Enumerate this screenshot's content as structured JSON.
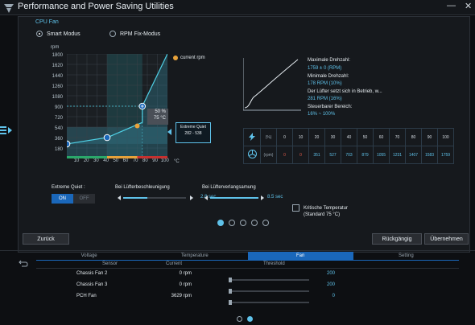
{
  "window": {
    "title": "Performance and Power Saving Utilities",
    "minimize": "—",
    "close": "✕"
  },
  "section": {
    "title": "CPU Fan"
  },
  "mode": {
    "smart": "Smart Modus",
    "fix": "RPM Fix-Modus",
    "selected": "smart"
  },
  "chart": {
    "ylabel": "rpm",
    "yticks": [
      "1800",
      "1620",
      "1440",
      "1260",
      "1080",
      "900",
      "720",
      "540",
      "360",
      "180"
    ],
    "xticks": [
      "10",
      "20",
      "30",
      "40",
      "50",
      "60",
      "70",
      "80",
      "90",
      "100"
    ],
    "xunit": "°C",
    "legend": "current rpm",
    "tooltip_pct": "50 %",
    "tooltip_temp": "75 °C",
    "badge_title": "Extreme Quiet",
    "badge_range": "282 - 538"
  },
  "chart_data": {
    "type": "line",
    "xlabel": "°C",
    "ylabel": "rpm",
    "x_range": [
      0,
      100
    ],
    "y_range": [
      0,
      1800
    ],
    "series": [
      {
        "name": "curve",
        "x": [
          0,
          40,
          75,
          75,
          100
        ],
        "y": [
          250,
          360,
          620,
          900,
          1800
        ]
      }
    ],
    "current": {
      "x": 70,
      "y": 560
    }
  },
  "info": {
    "max_label": "Maximale Drehzahl:",
    "max_val": "1759 ± 0 (RPM)",
    "min_label": "Minimale Drehzahl:",
    "min_val": "178 RPM (10%)",
    "start_label": "Der Lüfter setzt sich in Betrieb, w...",
    "start_val": "281 RPM (16%)",
    "range_label": "Steuerbarer Bereich:",
    "range_val": "16% ~ 100%"
  },
  "table": {
    "pct_header": "(%)",
    "rpm_header": "(rpm)",
    "pct": [
      "0",
      "10",
      "20",
      "30",
      "40",
      "50",
      "60",
      "70",
      "80",
      "90",
      "100"
    ],
    "rpm": [
      "0",
      "0",
      "351",
      "527",
      "703",
      "879",
      "1055",
      "1231",
      "1407",
      "1583",
      "1759"
    ]
  },
  "controls": {
    "eq_label": "Extreme Quiet :",
    "on": "ON",
    "off": "OFF",
    "accel_label": "Bei Lüfterbeschleunigung",
    "accel_val": "2.8 sec",
    "decel_label": "Bei Lüfterverlangsamung",
    "decel_val": "8.5 sec",
    "crit_label": "Kritische Temperatur",
    "crit_sub": "(Standard 75 °C)"
  },
  "buttons": {
    "back": "Zurück",
    "undo": "Rückgängig",
    "apply": "Übernehmen"
  },
  "tabs": [
    "Voltage",
    "Temperature",
    "Fan",
    "Setting"
  ],
  "active_tab": "Fan",
  "sensor_table": {
    "headers": [
      "Sensor",
      "Current",
      "Threshold"
    ],
    "rows": [
      {
        "sensor": "Chassis Fan 2",
        "current": "0 rpm",
        "threshold": "200"
      },
      {
        "sensor": "Chassis Fan 3",
        "current": "0 rpm",
        "threshold": "200"
      },
      {
        "sensor": "PCH Fan",
        "current": "3629 rpm",
        "threshold": "0"
      }
    ]
  },
  "colors": {
    "accent": "#5fc2ea",
    "tab_active": "#1a67ba",
    "green": "#2aa86a",
    "orange": "#e8a23a",
    "red": "#c6312f",
    "curve": "#4fd1e6"
  }
}
